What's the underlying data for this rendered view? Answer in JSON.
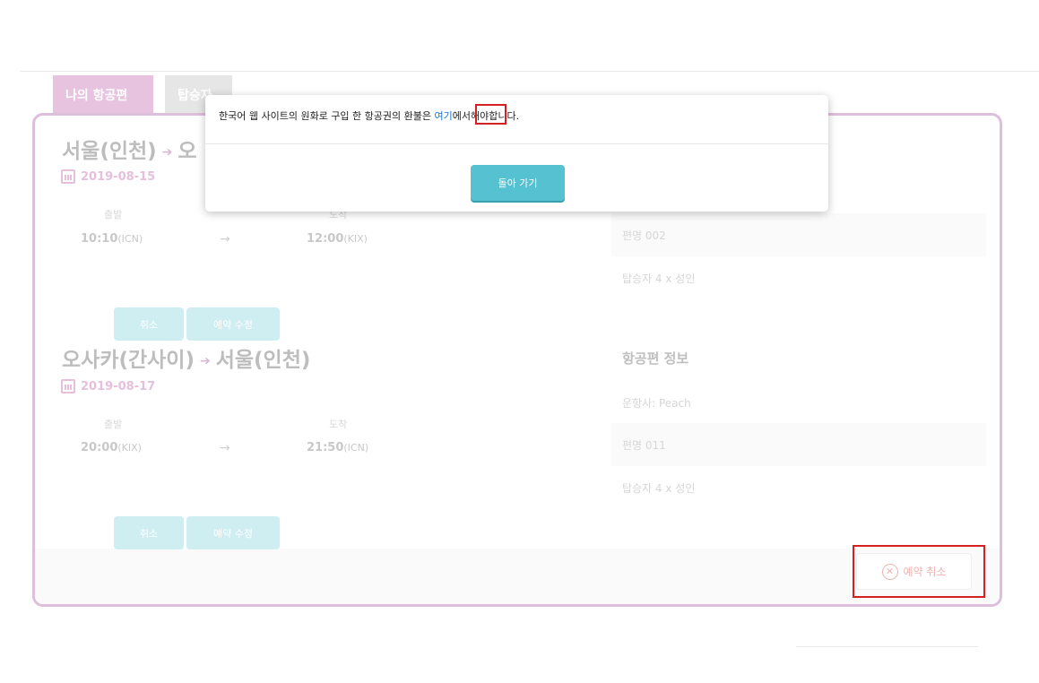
{
  "tabs": {
    "my_flights": "나의 항공편",
    "passengers": "탑승자"
  },
  "itinerary": [
    {
      "origin": "서울(인천)",
      "destination_partial": "오",
      "date": "2019-08-15",
      "depart_label": "출발",
      "arrive_label": "도착",
      "depart_time": "10:10",
      "depart_code": "(ICN)",
      "arrive_time": "12:00",
      "arrive_code": "(KIX)",
      "arrow": "→",
      "cancel_label": "취소",
      "modify_label": "예약 수정",
      "flight_no": "편명 002",
      "passengers": "탑승자 4 x 성인"
    },
    {
      "origin": "오사카(간사이)",
      "destination": "서울(인천)",
      "date": "2019-08-17",
      "depart_label": "출발",
      "arrive_label": "도착",
      "depart_time": "20:00",
      "depart_code": "(KIX)",
      "arrive_time": "21:50",
      "arrive_code": "(ICN)",
      "arrow": "→",
      "cancel_label": "취소",
      "modify_label": "예약 수정",
      "info_title": "항공편 정보",
      "operator": "운항사: Peach",
      "flight_no": "편명 011",
      "passengers": "탑승자 4 x 성인"
    }
  ],
  "title_arrow": "➔",
  "cancel_reservation": {
    "icon": "close-circle-icon",
    "label": "예약 취소"
  },
  "modal": {
    "text_before": "한국어 웹 사이트의 원화로 구입 한 항공권의 환불은 ",
    "link_text": "여기",
    "text_after": "에서해야합니다.",
    "back_button": "돌아 가기"
  },
  "colors": {
    "accent_pink": "#ddbfdc",
    "button_teal": "#56c1d0",
    "link_blue": "#1a73c8",
    "highlight_red": "#d32020"
  }
}
